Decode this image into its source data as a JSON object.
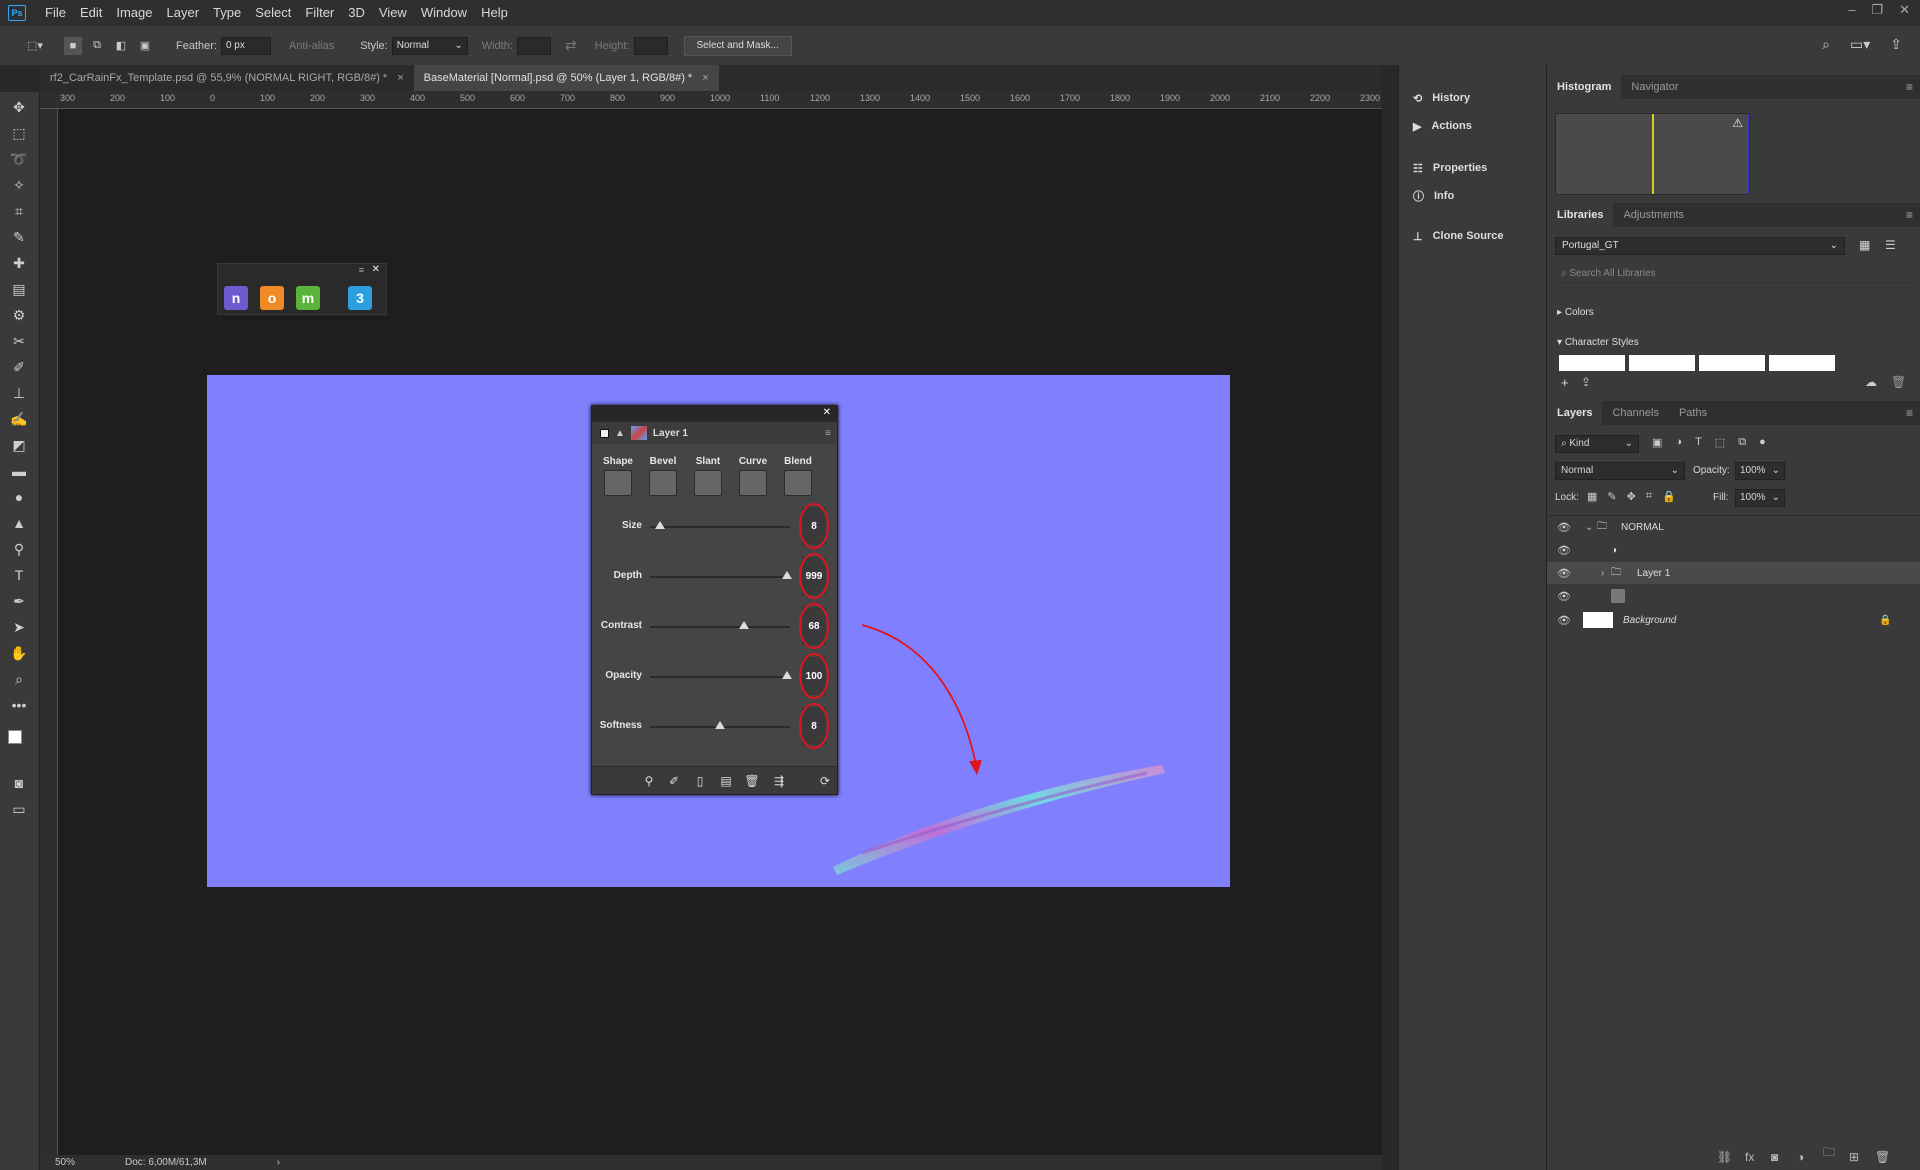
{
  "app": {
    "logo": "Ps"
  },
  "menu": [
    "File",
    "Edit",
    "Image",
    "Layer",
    "Type",
    "Select",
    "Filter",
    "3D",
    "View",
    "Window",
    "Help"
  ],
  "options": {
    "feather_label": "Feather:",
    "feather_value": "0 px",
    "antialias_label": "Anti-alias",
    "style_label": "Style:",
    "style_value": "Normal",
    "width_label": "Width:",
    "height_label": "Height:",
    "select_mask": "Select and Mask..."
  },
  "tabs": [
    {
      "label": "rf2_CarRainFx_Template.psd @ 55,9% (NORMAL RIGHT, RGB/8#) *"
    },
    {
      "label": "BaseMaterial [Normal].psd @ 50% (Layer 1, RGB/8#) *"
    }
  ],
  "ruler_ticks": [
    "300",
    "200",
    "100",
    "0",
    "100",
    "200",
    "300",
    "400",
    "500",
    "600",
    "700",
    "800",
    "900",
    "1000",
    "1100",
    "1200",
    "1300",
    "1400",
    "1500",
    "1600",
    "1700",
    "1800",
    "1900",
    "2000",
    "2100",
    "2200",
    "2300"
  ],
  "status": {
    "zoom": "50%",
    "doc": "Doc: 6,00M/61,3M"
  },
  "plugin_bar": {
    "icons": [
      "n",
      "o",
      "m",
      "3"
    ],
    "colors": [
      "#6d5bd0",
      "#f08a24",
      "#5ab43b",
      "#2aa0e0"
    ]
  },
  "float_panel": {
    "layer_name": "Layer 1",
    "tabs": [
      "Shape",
      "Bevel",
      "Slant",
      "Curve",
      "Blend"
    ],
    "rows": [
      {
        "label": "Size",
        "value": "8",
        "pos": 0.05
      },
      {
        "label": "Depth",
        "value": "999",
        "pos": 1.0
      },
      {
        "label": "Contrast",
        "value": "68",
        "pos": 0.68
      },
      {
        "label": "Opacity",
        "value": "100",
        "pos": 1.0
      },
      {
        "label": "Softness",
        "value": "8",
        "pos": 0.5
      }
    ]
  },
  "dock": [
    "History",
    "Actions",
    "Properties",
    "Info",
    "Clone Source"
  ],
  "histogram_tabs": [
    "Histogram",
    "Navigator"
  ],
  "libraries": {
    "tabs": [
      "Libraries",
      "Adjustments"
    ],
    "selected": "Portugal_GT",
    "search_placeholder": "Search All Libraries",
    "sections": [
      "Colors",
      "Character Styles"
    ]
  },
  "layers_panel": {
    "tabs": [
      "Layers",
      "Channels",
      "Paths"
    ],
    "kind": "Kind",
    "blend": "Normal",
    "opacity_label": "Opacity:",
    "opacity": "100%",
    "lock_label": "Lock:",
    "fill_label": "Fill:",
    "fill": "100%",
    "layers": [
      "NORMAL",
      "",
      "Layer 1",
      "",
      "Background"
    ]
  },
  "colors": {
    "canvas_bg": "#8080ff",
    "accent": "#31a8ff",
    "annotation": "#e0141e"
  }
}
